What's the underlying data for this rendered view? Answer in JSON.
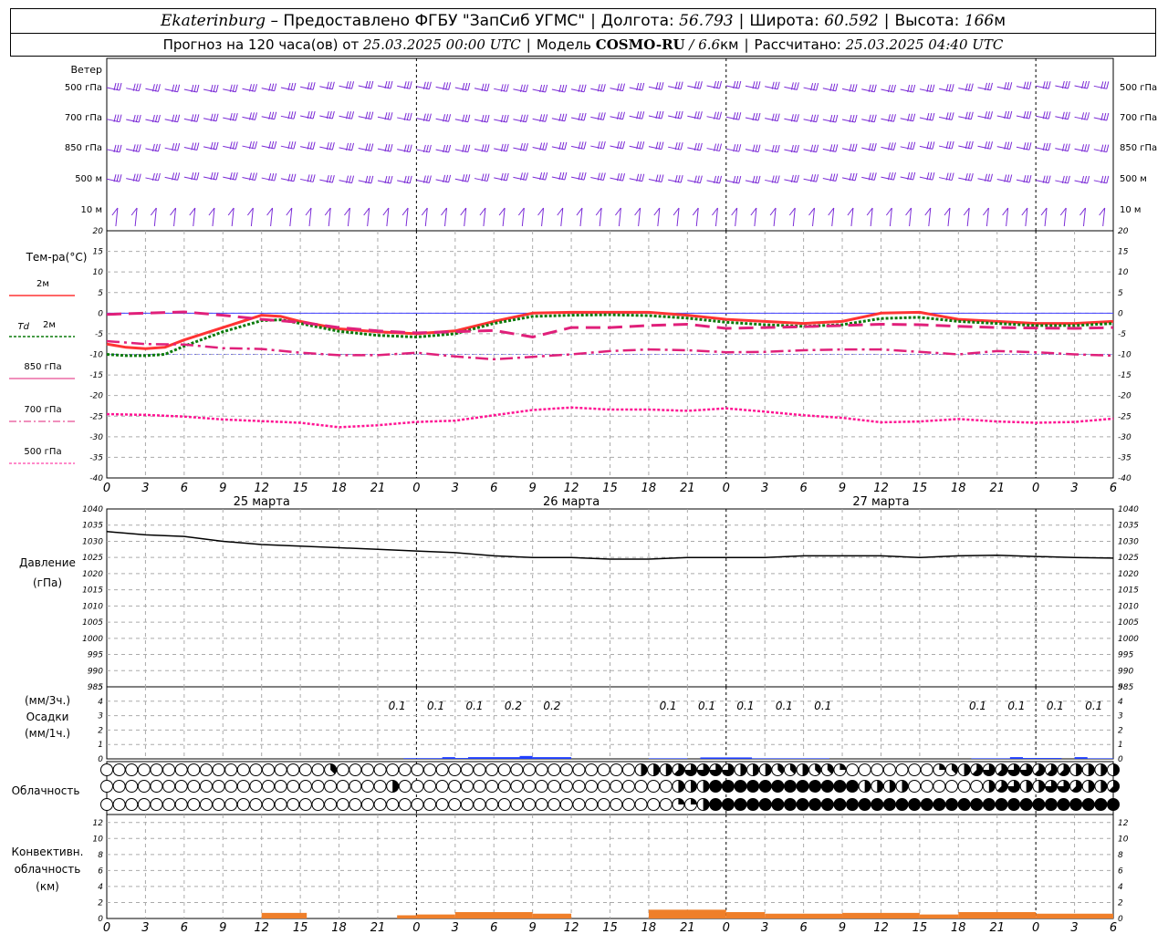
{
  "header": {
    "city": "Ekaterinburg",
    "provider": "– Предоставлено ФГБУ \"ЗапСиб УГМС\"",
    "lon_label": "Долгота:",
    "lon": "56.793",
    "lat_label": "Широта:",
    "lat": "60.592",
    "alt_label": "Высота:",
    "alt": "166",
    "alt_unit": "м",
    "forecast_label": "Прогноз на 120 часа(ов) от",
    "forecast_from": "25.03.2025 00:00 UTC",
    "model_label": "Модель",
    "model": "COSMO-RU",
    "model_res": "/ 6.6",
    "model_res_unit": "км",
    "calc_label": "Рассчитано:",
    "calc_time": "25.03.2025 04:40 UTC"
  },
  "labels": {
    "wind": "Ветер",
    "wind_levels": [
      "500 гПа",
      "700 гПа",
      "850 гПа",
      "500 м",
      "10 м"
    ],
    "temp": "Тем-ра(°C)",
    "temp_legend": [
      "2м",
      "2м",
      "850 гПа",
      "700 гПа",
      "500 гПа"
    ],
    "td_prefix": "Td",
    "pressure": [
      "Давление",
      "(гПа)"
    ],
    "precip": [
      "(мм/3ч.)",
      "Осадки",
      "(мм/1ч.)"
    ],
    "cloud": "Облачность",
    "conv": [
      "Конвективн.",
      "облачность",
      "(км)"
    ]
  },
  "colors": {
    "wind": "#7a2ad6",
    "t2m": "#ff3333",
    "td2m": "#0a7a0a",
    "t850": "#e0207a",
    "t700": "#e0207a",
    "t500": "#ff1493",
    "pressure": "#000000",
    "precip": "#1f3fff",
    "conv": "#ef7f2a",
    "ref_line": "#4040ff"
  },
  "chart_data": {
    "type": "line",
    "x_hours": [
      0,
      3,
      6,
      9,
      12,
      15,
      18,
      21,
      24,
      27,
      30,
      33,
      36,
      39,
      42,
      45,
      48,
      51,
      54,
      57,
      60,
      63,
      66,
      69,
      72,
      75,
      78
    ],
    "x_tick_labels": [
      "0",
      "3",
      "6",
      "9",
      "12",
      "15",
      "18",
      "21",
      "0",
      "3",
      "6",
      "9",
      "12",
      "15",
      "18",
      "21",
      "0",
      "3",
      "6",
      "9",
      "12",
      "15",
      "18",
      "21",
      "0",
      "3",
      "6"
    ],
    "dates": [
      {
        "hour": 12,
        "label": "25 марта"
      },
      {
        "hour": 36,
        "label": "26 марта"
      },
      {
        "hour": 60,
        "label": "27 марта"
      }
    ],
    "temperature": {
      "ylim": [
        -40,
        20
      ],
      "yticks": [
        20,
        15,
        10,
        5,
        0,
        -5,
        -10,
        -15,
        -20,
        -25,
        -30,
        -35,
        -40
      ],
      "series": [
        {
          "name": "2м",
          "x": [
            0,
            1.5,
            3,
            4.5,
            6,
            9,
            12,
            13.5,
            15,
            18,
            21,
            24,
            27,
            30,
            33,
            36,
            39,
            42,
            45,
            48,
            51,
            54,
            57,
            60,
            63,
            66,
            69,
            72,
            75,
            78
          ],
          "values": [
            -7.5,
            -8.3,
            -8.6,
            -8.3,
            -6.5,
            -3.5,
            -0.5,
            -0.8,
            -2,
            -3.8,
            -4.5,
            -5,
            -4.3,
            -2,
            0,
            0.2,
            0.2,
            0.2,
            -0.5,
            -1.5,
            -2,
            -2.5,
            -2,
            0,
            0.2,
            -1.5,
            -2,
            -2.5,
            -2.5,
            -2
          ]
        },
        {
          "name": "Td 2м",
          "x": [
            0,
            1.5,
            3,
            4.5,
            6,
            9,
            12,
            13.5,
            15,
            18,
            21,
            24,
            27,
            30,
            33,
            36,
            39,
            42,
            45,
            48,
            51,
            54,
            57,
            60,
            63,
            66,
            69,
            72,
            75,
            78
          ],
          "values": [
            -10,
            -10.3,
            -10.3,
            -10,
            -8,
            -4.5,
            -1.8,
            -1.6,
            -2.5,
            -4.4,
            -5.4,
            -5.8,
            -5,
            -2.5,
            -0.8,
            -0.5,
            -0.4,
            -0.6,
            -1.2,
            -2.2,
            -2.8,
            -3.2,
            -2.8,
            -1.3,
            -1,
            -2,
            -2.5,
            -3,
            -3,
            -2.5
          ]
        },
        {
          "name": "850 гПа",
          "x": [
            0,
            3,
            6,
            9,
            12,
            15,
            18,
            21,
            24,
            27,
            30,
            33,
            36,
            39,
            42,
            45,
            48,
            51,
            54,
            57,
            60,
            63,
            66,
            69,
            72,
            75,
            78
          ],
          "values": [
            -0.3,
            0,
            0.3,
            -0.5,
            -1.5,
            -2.2,
            -3.5,
            -4.3,
            -4.8,
            -4.5,
            -4.2,
            -5.8,
            -3.5,
            -3.5,
            -3,
            -2.7,
            -3.7,
            -3.5,
            -3.3,
            -3,
            -2.7,
            -2.8,
            -3.2,
            -3.5,
            -3.6,
            -3.7,
            -3.5
          ]
        },
        {
          "name": "700 гПа",
          "x": [
            0,
            3,
            6,
            9,
            12,
            15,
            18,
            21,
            24,
            27,
            30,
            33,
            36,
            39,
            42,
            45,
            48,
            51,
            54,
            57,
            60,
            63,
            66,
            69,
            72,
            75,
            78
          ],
          "values": [
            -6.8,
            -7.5,
            -7.6,
            -8.5,
            -8.7,
            -9.6,
            -10.2,
            -10.2,
            -9.6,
            -10.5,
            -11.2,
            -10.6,
            -10,
            -9.2,
            -8.8,
            -9,
            -9.5,
            -9.4,
            -9,
            -8.8,
            -8.8,
            -9.4,
            -10,
            -9.2,
            -9.5,
            -10,
            -10.3
          ]
        },
        {
          "name": "500 гПа",
          "x": [
            0,
            3,
            6,
            9,
            12,
            15,
            18,
            21,
            24,
            27,
            30,
            33,
            36,
            39,
            42,
            45,
            48,
            51,
            54,
            57,
            60,
            63,
            66,
            69,
            72,
            75,
            78
          ],
          "values": [
            -24.5,
            -24.7,
            -25.1,
            -25.8,
            -26.2,
            -26.6,
            -27.7,
            -27.2,
            -26.4,
            -26.1,
            -24.8,
            -23.5,
            -22.9,
            -23.4,
            -23.4,
            -23.7,
            -23.1,
            -23.9,
            -24.8,
            -25.4,
            -26.5,
            -26.3,
            -25.7,
            -26.3,
            -26.6,
            -26.4,
            -25.6
          ]
        }
      ]
    },
    "pressure": {
      "ylim": [
        985,
        1040
      ],
      "yticks": [
        1040,
        1035,
        1030,
        1025,
        1020,
        1015,
        1010,
        1005,
        1000,
        995,
        990,
        985
      ],
      "x": [
        0,
        3,
        6,
        9,
        12,
        15,
        18,
        21,
        24,
        27,
        30,
        33,
        36,
        39,
        42,
        45,
        48,
        51,
        54,
        57,
        60,
        63,
        66,
        69,
        72,
        75,
        78
      ],
      "values": [
        1033,
        1032,
        1031.5,
        1030,
        1029,
        1028.5,
        1028,
        1027.5,
        1027,
        1026.5,
        1025.5,
        1025,
        1025,
        1024.5,
        1024.5,
        1025,
        1025,
        1025,
        1025.5,
        1025.5,
        1025.5,
        1025,
        1025.5,
        1025.7,
        1025.3,
        1025,
        1024.8
      ]
    },
    "precipitation": {
      "ylim": [
        0,
        5
      ],
      "yticks": [
        5,
        4,
        3,
        2,
        1,
        0
      ],
      "labels": [
        {
          "hour": 22.5,
          "text": "0.1"
        },
        {
          "hour": 25.5,
          "text": "0.1"
        },
        {
          "hour": 28.5,
          "text": "0.1"
        },
        {
          "hour": 31.5,
          "text": "0.2"
        },
        {
          "hour": 34.5,
          "text": "0.2"
        },
        {
          "hour": 43.5,
          "text": "0.1"
        },
        {
          "hour": 46.5,
          "text": "0.1"
        },
        {
          "hour": 49.5,
          "text": "0.1"
        },
        {
          "hour": 52.5,
          "text": "0.1"
        },
        {
          "hour": 55.5,
          "text": "0.1"
        },
        {
          "hour": 67.5,
          "text": "0.1"
        },
        {
          "hour": 70.5,
          "text": "0.1"
        },
        {
          "hour": 73.5,
          "text": "0.1"
        },
        {
          "hour": 76.5,
          "text": "0.1"
        }
      ],
      "hourly_mm": [
        {
          "from": 23,
          "to": 26,
          "mm": 0.05
        },
        {
          "from": 26,
          "to": 27,
          "mm": 0.12
        },
        {
          "from": 27,
          "to": 28,
          "mm": 0.06
        },
        {
          "from": 28,
          "to": 32,
          "mm": 0.12
        },
        {
          "from": 32,
          "to": 33,
          "mm": 0.2
        },
        {
          "from": 33,
          "to": 36,
          "mm": 0.12
        },
        {
          "from": 42,
          "to": 45,
          "mm": 0.04
        },
        {
          "from": 46,
          "to": 50,
          "mm": 0.1
        },
        {
          "from": 50,
          "to": 56,
          "mm": 0.04
        },
        {
          "from": 67,
          "to": 70,
          "mm": 0.04
        },
        {
          "from": 70,
          "to": 71,
          "mm": 0.12
        },
        {
          "from": 71,
          "to": 74,
          "mm": 0.06
        },
        {
          "from": 75,
          "to": 76,
          "mm": 0.12
        },
        {
          "from": 76,
          "to": 78,
          "mm": 0.04
        }
      ]
    },
    "cloud_cover_levels": [
      "upper",
      "middle",
      "lower"
    ],
    "cloud_cover_octas": [
      [
        0,
        0,
        0,
        0,
        0,
        0,
        0,
        0,
        0,
        0,
        0,
        0,
        0,
        0,
        0,
        0,
        0,
        0,
        3,
        0,
        0,
        0,
        0,
        0,
        0,
        0,
        0,
        0,
        0,
        0,
        0,
        0,
        0,
        0,
        0,
        0,
        0,
        0,
        0,
        0,
        0,
        0,
        0,
        4,
        4,
        4,
        5,
        6,
        6,
        6,
        6,
        4,
        4,
        4,
        3,
        3,
        4,
        3,
        3,
        2,
        0,
        0,
        0,
        0,
        0,
        0,
        0,
        2,
        3,
        4,
        5,
        6,
        5,
        6,
        6,
        5,
        5,
        5,
        4,
        4,
        4,
        4
      ],
      [
        0,
        0,
        0,
        0,
        0,
        0,
        0,
        0,
        0,
        0,
        0,
        0,
        0,
        0,
        0,
        0,
        0,
        0,
        0,
        0,
        0,
        0,
        0,
        4,
        0,
        0,
        0,
        0,
        0,
        0,
        0,
        0,
        0,
        0,
        0,
        0,
        0,
        0,
        0,
        0,
        0,
        0,
        0,
        0,
        0,
        0,
        4,
        4,
        4,
        8,
        8,
        8,
        8,
        8,
        8,
        8,
        8,
        8,
        8,
        8,
        8,
        4,
        4,
        4,
        4,
        0,
        0,
        0,
        0,
        0,
        0,
        4,
        5,
        6,
        4,
        4,
        6,
        6,
        5,
        4,
        4,
        5
      ],
      [
        0,
        0,
        0,
        0,
        0,
        0,
        0,
        0,
        0,
        0,
        0,
        0,
        0,
        0,
        0,
        0,
        0,
        0,
        0,
        0,
        0,
        0,
        0,
        0,
        0,
        0,
        0,
        0,
        0,
        0,
        0,
        0,
        0,
        0,
        0,
        0,
        0,
        0,
        0,
        0,
        0,
        0,
        0,
        0,
        0,
        0,
        2,
        2,
        4,
        8,
        8,
        8,
        8,
        8,
        8,
        8,
        8,
        8,
        8,
        8,
        8,
        8,
        8,
        8,
        8,
        8,
        8,
        8,
        8,
        8,
        8,
        8,
        8,
        8,
        8,
        8,
        8,
        8,
        8,
        8,
        8,
        8
      ]
    ],
    "convective_cloud": {
      "ylim": [
        0,
        13
      ],
      "yticks": [
        12,
        10,
        8,
        6,
        4,
        2,
        0
      ],
      "segments": [
        {
          "from": 12,
          "to": 15.5,
          "km": 0.7
        },
        {
          "from": 22.5,
          "to": 24,
          "km": 0.4
        },
        {
          "from": 24,
          "to": 27,
          "km": 0.5
        },
        {
          "from": 27,
          "to": 33,
          "km": 0.8
        },
        {
          "from": 33,
          "to": 36,
          "km": 0.6
        },
        {
          "from": 42,
          "to": 48,
          "km": 1.1
        },
        {
          "from": 48,
          "to": 51,
          "km": 0.8
        },
        {
          "from": 51,
          "to": 57,
          "km": 0.6
        },
        {
          "from": 57,
          "to": 63,
          "km": 0.7
        },
        {
          "from": 63,
          "to": 66,
          "km": 0.5
        },
        {
          "from": 66,
          "to": 72,
          "km": 0.8
        },
        {
          "from": 72,
          "to": 78,
          "km": 0.6
        }
      ]
    },
    "wind_barbs": {
      "levels": [
        "500 гПа",
        "700 гПа",
        "850 гПа",
        "500 м",
        "10 м"
      ]
    }
  }
}
